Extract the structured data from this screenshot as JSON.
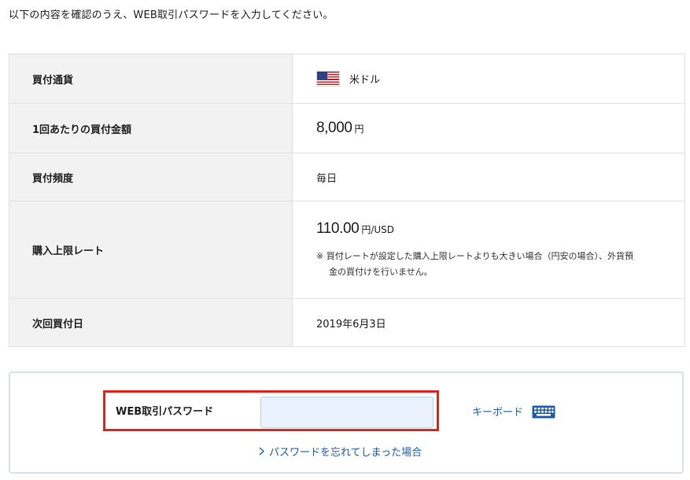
{
  "intro": "以下の内容を確認のうえ、WEB取引パスワードを入力してください。",
  "rows": {
    "currency": {
      "label": "買付通貨",
      "value": "米ドル",
      "flag": "us-flag-icon"
    },
    "amount": {
      "label": "1回あたりの買付金額",
      "value": "8,000",
      "unit": "円"
    },
    "frequency": {
      "label": "買付頻度",
      "value": "毎日"
    },
    "rate": {
      "label": "購入上限レート",
      "value": "110.00",
      "unit": "円/USD",
      "note_line1": "※ 買付レートが設定した購入上限レートよりも大きい場合（円安の場合）、外貨預",
      "note_line2": "金の買付けを行いません。"
    },
    "next": {
      "label": "次回買付日",
      "value": "2019年6月3日"
    }
  },
  "password": {
    "label": "WEB取引パスワード",
    "input_value": "",
    "keyboard_label": "キーボード",
    "forgot_label": "パスワードを忘れてしまった場合"
  },
  "colors": {
    "link": "#1c5fa8",
    "highlight": "#e2261f",
    "input_bg": "#eaf2fd",
    "label_bg": "#f2f2f2"
  }
}
